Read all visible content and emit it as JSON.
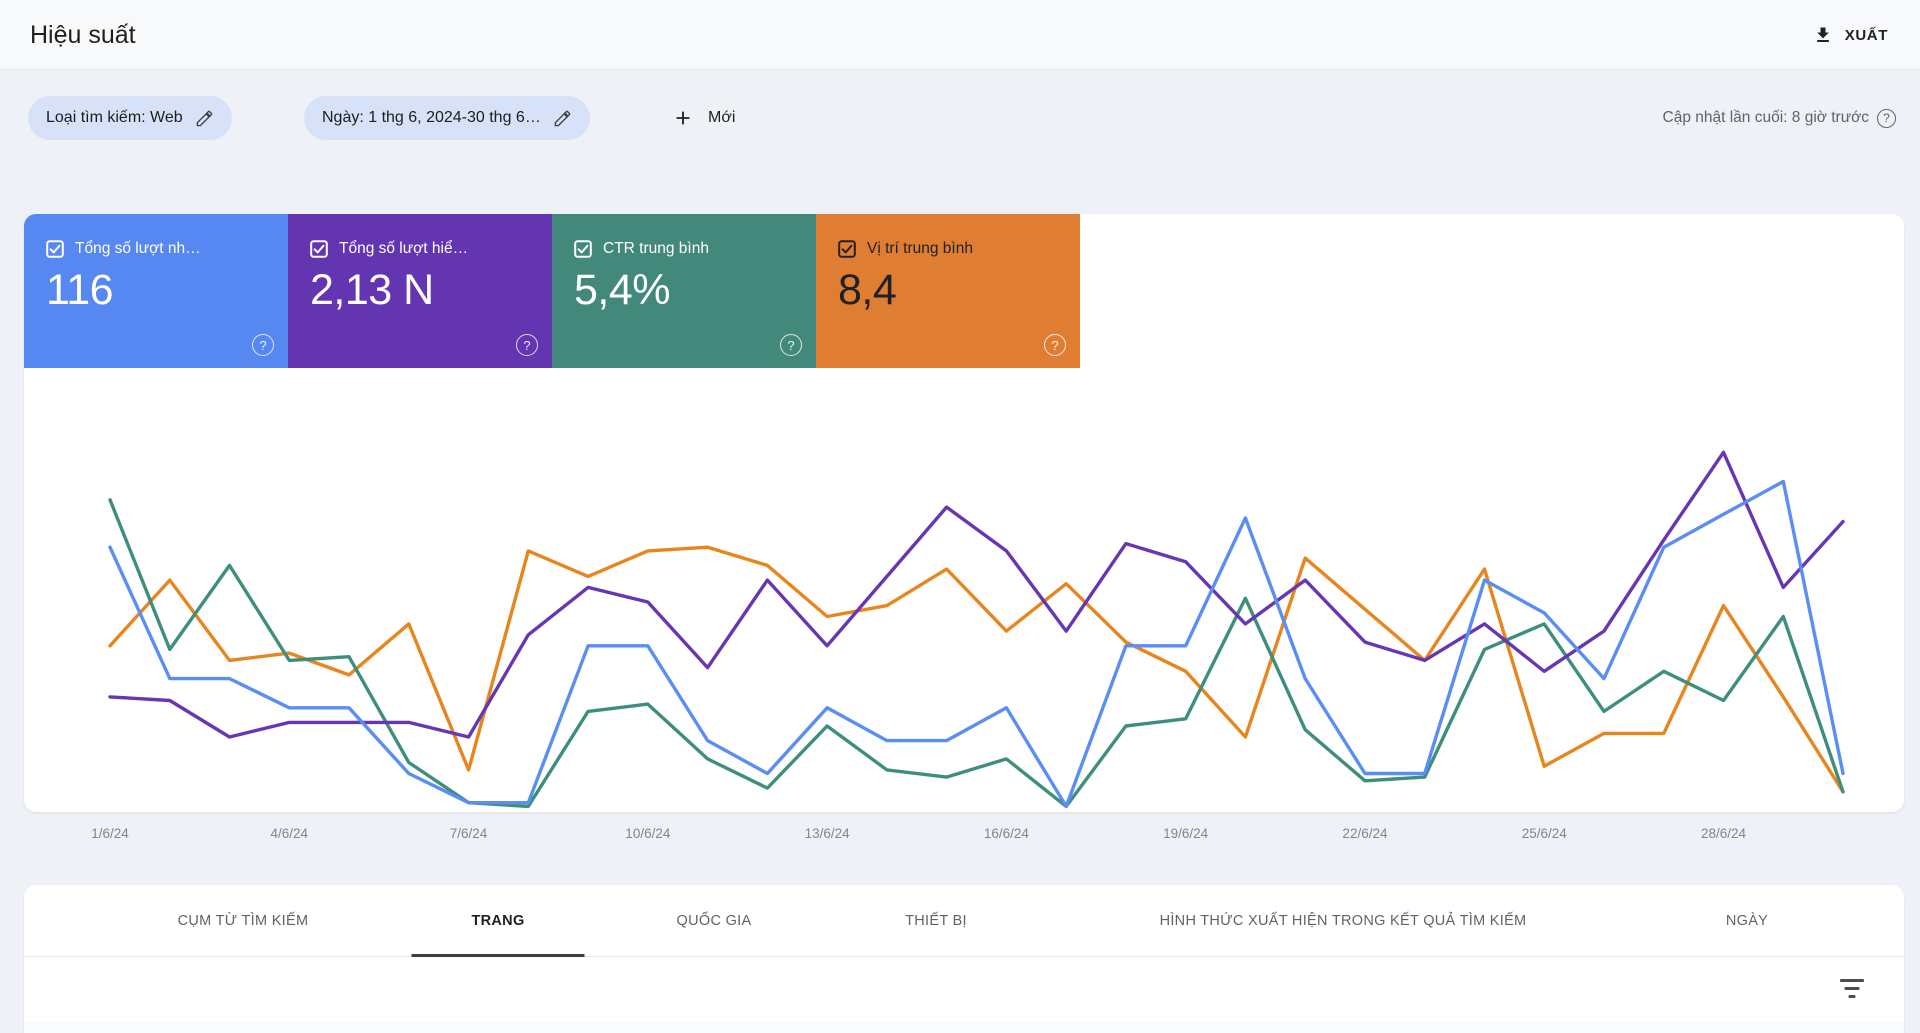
{
  "header": {
    "title": "Hiệu suất",
    "export_label": "XUẤT"
  },
  "filter_bar": {
    "search_type_chip": "Loại tìm kiếm: Web",
    "date_chip": "Ngày: 1 thg 6, 2024-30 thg 6…",
    "new_button": "Mới",
    "last_updated": "Cập nhật lần cuối: 8 giờ trước"
  },
  "metrics": [
    {
      "id": "clicks",
      "label": "Tổng số lượt nh…",
      "value": "116",
      "checked": true,
      "color": "#5787f1",
      "text_color": "#ffffff"
    },
    {
      "id": "impressions",
      "label": "Tổng số lượt hiể…",
      "value": "2,13 N",
      "checked": true,
      "color": "#6435b0",
      "text_color": "#ffffff"
    },
    {
      "id": "ctr",
      "label": "CTR trung bình",
      "value": "5,4%",
      "checked": true,
      "color": "#43897b",
      "text_color": "#ffffff"
    },
    {
      "id": "position",
      "label": "Vị trí trung bình",
      "value": "8,4",
      "checked": true,
      "color": "#df7d32",
      "text_color": "#202124"
    }
  ],
  "chart_data": {
    "type": "line",
    "title": "",
    "xlabel": "",
    "ylabel": "",
    "grid": false,
    "legend": "none (series toggled via colored metric cards)",
    "y_units": "relative height 0-100 (no y-axis labels are visible in the chart)",
    "ylim": [
      0,
      100
    ],
    "categories": [
      "1/6/24",
      "2/6/24",
      "3/6/24",
      "4/6/24",
      "5/6/24",
      "6/6/24",
      "7/6/24",
      "8/6/24",
      "9/6/24",
      "10/6/24",
      "11/6/24",
      "12/6/24",
      "13/6/24",
      "14/6/24",
      "15/6/24",
      "16/6/24",
      "17/6/24",
      "18/6/24",
      "19/6/24",
      "20/6/24",
      "21/6/24",
      "22/6/24",
      "23/6/24",
      "24/6/24",
      "25/6/24",
      "26/6/24",
      "27/6/24",
      "28/6/24",
      "29/6/24",
      "30/6/24"
    ],
    "tick_labels": [
      "1/6/24",
      "4/6/24",
      "7/6/24",
      "10/6/24",
      "13/6/24",
      "16/6/24",
      "19/6/24",
      "22/6/24",
      "25/6/24",
      "28/6/24"
    ],
    "tick_every": 3,
    "draw_order": [
      "position",
      "ctr",
      "impressions",
      "clicks"
    ],
    "series": [
      {
        "id": "clicks",
        "name": "Tổng số lượt nhấp",
        "color": "#5a8ef6",
        "values": [
          72,
          36,
          36,
          28,
          28,
          10,
          2,
          2,
          45,
          45,
          19,
          10,
          28,
          19,
          19,
          28,
          1,
          45,
          45,
          80,
          36,
          10,
          10,
          63,
          54,
          36,
          72,
          81,
          90,
          10
        ]
      },
      {
        "id": "impressions",
        "name": "Tổng số lượt hiển thị",
        "color": "#6636b4",
        "values": [
          31,
          30,
          20,
          24,
          24,
          24,
          20,
          48,
          61,
          57,
          39,
          63,
          45,
          64,
          83,
          71,
          49,
          73,
          68,
          51,
          63,
          46,
          41,
          51,
          38,
          49,
          74,
          98,
          61,
          79
        ]
      },
      {
        "id": "ctr",
        "name": "CTR trung bình",
        "color": "#3e8e7e",
        "values": [
          85,
          44,
          67,
          41,
          42,
          13,
          2,
          1,
          27,
          29,
          14,
          6,
          23,
          11,
          9,
          14,
          1,
          23,
          25,
          58,
          22,
          8,
          9,
          44,
          51,
          27,
          38,
          30,
          53,
          5
        ]
      },
      {
        "id": "position",
        "name": "Vị trí trung bình",
        "color": "#e8861d",
        "values": [
          45,
          63,
          41,
          43,
          37,
          51,
          11,
          71,
          64,
          71,
          72,
          67,
          53,
          56,
          66,
          49,
          62,
          46,
          38,
          20,
          69,
          55,
          41,
          66,
          12,
          21,
          21,
          56,
          31,
          5
        ]
      }
    ]
  },
  "tabs": {
    "active_index": 1,
    "items": [
      {
        "label": "CỤM TỪ TÌM KIẾM"
      },
      {
        "label": "TRANG"
      },
      {
        "label": "QUỐC GIA"
      },
      {
        "label": "THIẾT BỊ"
      },
      {
        "label": "HÌNH THỨC XUẤT HIỆN TRONG KẾT QUẢ TÌM KIẾM"
      },
      {
        "label": "NGÀY"
      }
    ]
  }
}
